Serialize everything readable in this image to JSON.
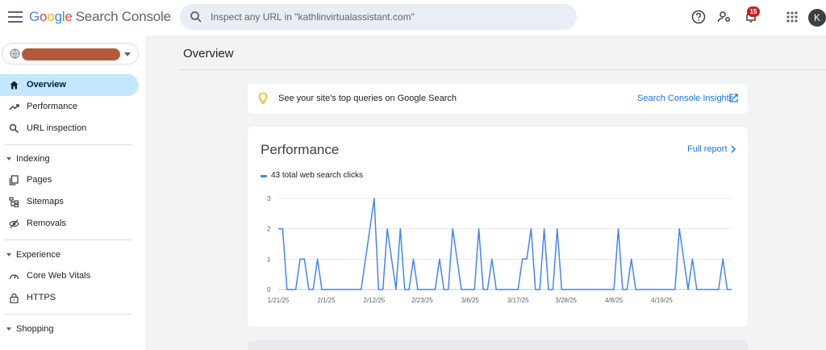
{
  "header": {
    "logo_letters": [
      "G",
      "o",
      "o",
      "g",
      "l",
      "e"
    ],
    "product_name": "Search Console",
    "search_placeholder": "Inspect any URL in \"kathlinvirtualassistant.com\"",
    "notification_count": "15",
    "avatar_initial": "K",
    "icons": [
      "menu-icon",
      "search-icon",
      "help-icon",
      "manage-users-icon",
      "notifications-icon",
      "apps-icon"
    ]
  },
  "sidebar": {
    "property_name": "",
    "items": [
      {
        "label": "Overview",
        "icon": "home-icon",
        "active": true
      },
      {
        "label": "Performance",
        "icon": "trending-up-icon"
      },
      {
        "label": "URL inspection",
        "icon": "search-icon"
      }
    ],
    "sections": [
      {
        "title": "Indexing",
        "items": [
          {
            "label": "Pages",
            "icon": "pages-icon"
          },
          {
            "label": "Sitemaps",
            "icon": "sitemap-icon"
          },
          {
            "label": "Removals",
            "icon": "removals-icon"
          }
        ]
      },
      {
        "title": "Experience",
        "items": [
          {
            "label": "Core Web Vitals",
            "icon": "speedometer-icon"
          },
          {
            "label": "HTTPS",
            "icon": "lock-icon"
          }
        ]
      },
      {
        "title": "Shopping",
        "items": []
      }
    ]
  },
  "main": {
    "title": "Overview",
    "insight": {
      "text": "See your site's top queries on Google Search",
      "link": "Search Console Insights"
    },
    "performance": {
      "title": "Performance",
      "link": "Full report"
    }
  },
  "colors": {
    "accent": "#1a73e8",
    "line": "#4285f4",
    "active_nav": "#c2e7ff",
    "badge": "#c5221f",
    "redaction": "#b35a3c"
  },
  "chart_data": {
    "type": "line",
    "series": [
      {
        "name": "43 total web search clicks",
        "values": [
          2,
          2,
          0,
          0,
          0,
          1,
          1,
          0,
          0,
          1,
          0,
          0,
          0,
          0,
          0,
          0,
          0,
          0,
          0,
          0,
          1,
          2,
          3,
          0,
          0,
          2,
          1,
          0,
          2,
          0,
          0,
          1,
          0,
          0,
          0,
          0,
          0,
          1,
          0,
          0,
          2,
          1,
          0,
          0,
          0,
          0,
          2,
          0,
          0,
          1,
          0,
          0,
          0,
          0,
          0,
          0,
          1,
          1,
          2,
          0,
          0,
          2,
          0,
          0,
          2,
          0,
          0,
          0,
          0,
          0,
          0,
          0,
          0,
          0,
          0,
          0,
          0,
          0,
          2,
          0,
          0,
          1,
          0,
          0,
          0,
          0,
          0,
          0,
          0,
          0,
          0,
          0,
          2,
          1,
          0,
          1,
          0,
          0,
          0,
          0,
          0,
          0,
          1,
          0,
          0
        ]
      }
    ],
    "x_start": "1/21/25",
    "x_ticks": [
      "1/21/25",
      "2/1/25",
      "2/12/25",
      "2/23/25",
      "3/6/25",
      "3/17/25",
      "3/28/25",
      "4/8/25",
      "4/19/25"
    ],
    "y_ticks": [
      0,
      1,
      2,
      3
    ],
    "ylim": [
      0,
      3
    ],
    "grid": true
  }
}
